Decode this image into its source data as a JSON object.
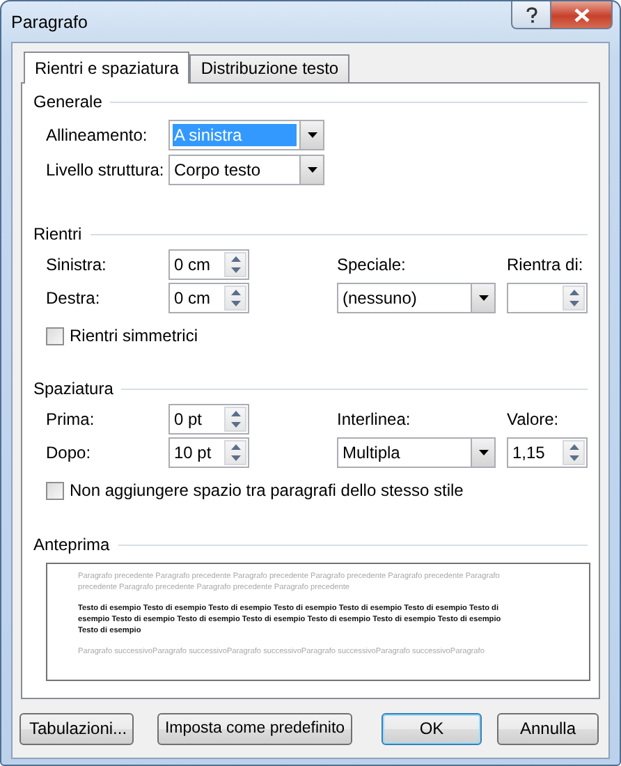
{
  "window": {
    "title": "Paragrafo"
  },
  "tabs": [
    {
      "label": "Rientri e spaziatura",
      "selected": true
    },
    {
      "label": "Distribuzione testo",
      "selected": false
    }
  ],
  "generale": {
    "title": "Generale",
    "fields": [
      {
        "label": "Allineamento:",
        "value": "A sinistra",
        "highlighted": true
      },
      {
        "label": "Livello struttura:",
        "value": "Corpo testo",
        "highlighted": false
      }
    ]
  },
  "rientri": {
    "title": "Rientri",
    "left": {
      "label": "Sinistra:",
      "value": "0 cm"
    },
    "right": {
      "label": "Destra:",
      "value": "0 cm"
    },
    "special": {
      "label": "Speciale:",
      "value": "(nessuno)"
    },
    "amount": {
      "label": "Rientra di:"
    },
    "option": {
      "label": "Rientri simmetrici",
      "checked": false
    }
  },
  "spaziatura": {
    "title": "Spaziatura",
    "left": {
      "label": "Prima:",
      "value": "0 pt"
    },
    "right": {
      "label": "Dopo:",
      "value": "10 pt"
    },
    "special": {
      "label": "Interlinea:",
      "value": "Multipla"
    },
    "amount": {
      "label": "Valore:",
      "value": "1,15"
    },
    "option": {
      "label": "Non aggiungere spazio tra paragrafi dello stesso stile",
      "checked": false
    }
  },
  "anteprima": {
    "title": "Anteprima",
    "previous": "Paragrafo precedente Paragrafo precedente Paragrafo precedente Paragrafo precedente Paragrafo precedente Paragrafo precedente Paragrafo precedente Paragrafo precedente Paragrafo precedente",
    "sample": "Testo di esempio Testo di esempio Testo di esempio Testo di esempio Testo di esempio Testo di esempio Testo di esempio Testo di esempio Testo di esempio Testo di esempio Testo di esempio Testo di esempio Testo di esempio Testo di esempio",
    "next": "Paragrafo successivoParagrafo successivoParagrafo successivoParagrafo successivoParagrafo successivoParagrafo"
  },
  "buttons": [
    {
      "label": "Tabulazioni...",
      "default": false
    },
    {
      "label": "Imposta come predefinito",
      "default": false
    },
    {
      "label": "OK",
      "default": true
    },
    {
      "label": "Annulla",
      "default": false
    }
  ]
}
